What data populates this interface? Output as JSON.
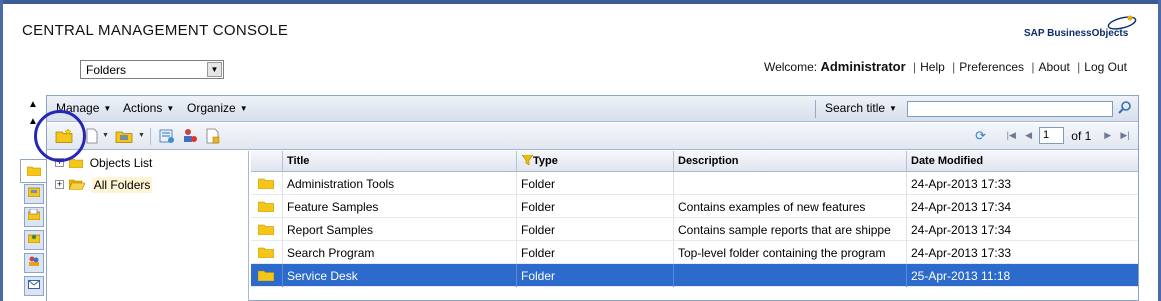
{
  "app_title": "CENTRAL MANAGEMENT CONSOLE",
  "logo": {
    "text_1": "SAP Business",
    "text_2": "Objects"
  },
  "nav_select": {
    "value": "Folders"
  },
  "welcome": {
    "prefix": "Welcome:",
    "user": "Administrator",
    "links": [
      "Help",
      "Preferences",
      "About",
      "Log Out"
    ]
  },
  "menu": {
    "items": [
      "Manage",
      "Actions",
      "Organize"
    ],
    "search_label": "Search title",
    "search_value": ""
  },
  "pager": {
    "page": "1",
    "of_text": "of 1"
  },
  "tree": {
    "items": [
      {
        "label": "Objects List"
      },
      {
        "label": "All Folders"
      }
    ]
  },
  "grid": {
    "columns": [
      "Title",
      "Type",
      "Description",
      "Date Modified"
    ],
    "rows": [
      {
        "title": "Administration Tools",
        "type": "Folder",
        "description": "",
        "date": "24-Apr-2013 17:33"
      },
      {
        "title": "Feature Samples",
        "type": "Folder",
        "description": "Contains examples of new features",
        "date": "24-Apr-2013 17:34"
      },
      {
        "title": "Report Samples",
        "type": "Folder",
        "description": "Contains sample reports that are shippe",
        "date": "24-Apr-2013 17:34"
      },
      {
        "title": "Search Program",
        "type": "Folder",
        "description": "Top-level folder containing the program",
        "date": "24-Apr-2013 17:33"
      },
      {
        "title": "Service Desk",
        "type": "Folder",
        "description": "",
        "date": "25-Apr-2013 11:18"
      }
    ],
    "selected_row_color": "#2c6bcb"
  },
  "colors": {
    "frame_border": "#8ea4c9",
    "annotation_circle": "#2626b8",
    "folder_yellow": "#f5c518"
  }
}
